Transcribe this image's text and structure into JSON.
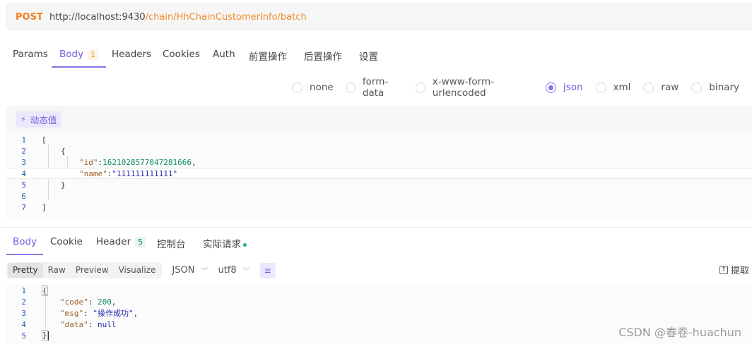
{
  "request": {
    "method": "POST",
    "url_host": "http://localhost:9430",
    "url_path": "/chain/HhChainCustomerInfo/batch"
  },
  "request_tabs": [
    {
      "label": "Params"
    },
    {
      "label": "Body",
      "badge": "1"
    },
    {
      "label": "Headers"
    },
    {
      "label": "Cookies"
    },
    {
      "label": "Auth"
    },
    {
      "label": "前置操作"
    },
    {
      "label": "后置操作"
    },
    {
      "label": "设置"
    }
  ],
  "body_types": [
    "none",
    "form-data",
    "x-www-form-urlencoded",
    "json",
    "xml",
    "raw",
    "binary"
  ],
  "selected_body_type": "json",
  "dynamic_value_label": "动态值",
  "request_body_lines": [
    "1",
    "2",
    "3",
    "4",
    "5",
    "6",
    "7"
  ],
  "request_json": {
    "open": "[",
    "obj_open": "{",
    "id_key": "\"id\"",
    "id_val": "1621028577047281666",
    "name_key": "\"name\"",
    "name_val": "\"111111111111\"",
    "obj_close": "}",
    "close": "]"
  },
  "response_tabs": [
    {
      "label": "Body"
    },
    {
      "label": "Cookie"
    },
    {
      "label": "Header",
      "badge": "5"
    },
    {
      "label": "控制台"
    },
    {
      "label": "实际请求"
    }
  ],
  "view_modes": [
    "Pretty",
    "Raw",
    "Preview",
    "Visualize"
  ],
  "selected_view_mode": "Pretty",
  "format_select": "JSON",
  "encoding_select": "utf8",
  "extract_label": "提取",
  "response_lines": [
    "1",
    "2",
    "3",
    "4",
    "5"
  ],
  "response_json": {
    "open": "{",
    "code_key": "\"code\"",
    "code_val": "200",
    "msg_key": "\"msg\"",
    "msg_val": "\"操作成功\"",
    "data_key": "\"data\"",
    "data_val": "null",
    "close": "}"
  },
  "watermark": "CSDN @春卷-huachun",
  "colors": {
    "accent": "#8b6fe6",
    "method": "#f0821e",
    "url_path": "#f08c28"
  }
}
